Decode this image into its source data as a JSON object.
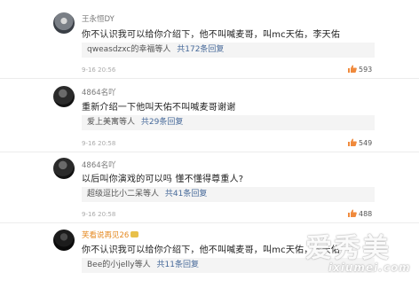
{
  "comments": [
    {
      "username": "王永恒DY",
      "text": "你不认识我可以给你介绍下，他不叫喊麦哥，叫mc天佑，李天佑",
      "reply_who": "qweasdzxc的幸福等人",
      "reply_link": "共172条回复",
      "time": "9-16 20:56",
      "likes": "593"
    },
    {
      "username": "4864名吖",
      "text": "重新介绍一下他叫天佑不叫喊麦哥谢谢",
      "reply_who": "爱上美寓等人",
      "reply_link": "共29条回复",
      "time": "9-16 20:58",
      "likes": "549"
    },
    {
      "username": "4864名吖",
      "text": "以后叫你演戏的可以吗 懂不懂得尊重人?",
      "reply_who": "超级逗比小二呆等人",
      "reply_link": "共41条回复",
      "time": "9-16 20:58",
      "likes": "488"
    },
    {
      "username": "芙看说再见26",
      "text": "你不认识我可以给你介绍下，他不叫喊麦哥，叫mc天佑，李天佑",
      "reply_who": "Bee的小jelly等人",
      "reply_link": "共11条回复",
      "time": "",
      "likes": ""
    }
  ],
  "watermark": {
    "big": "爱秀美",
    "small": "ixiumei.com"
  },
  "colors": {
    "like_icon": "#f08a3c",
    "link_blue": "#476a9a",
    "orange_username": "#e58a22"
  }
}
